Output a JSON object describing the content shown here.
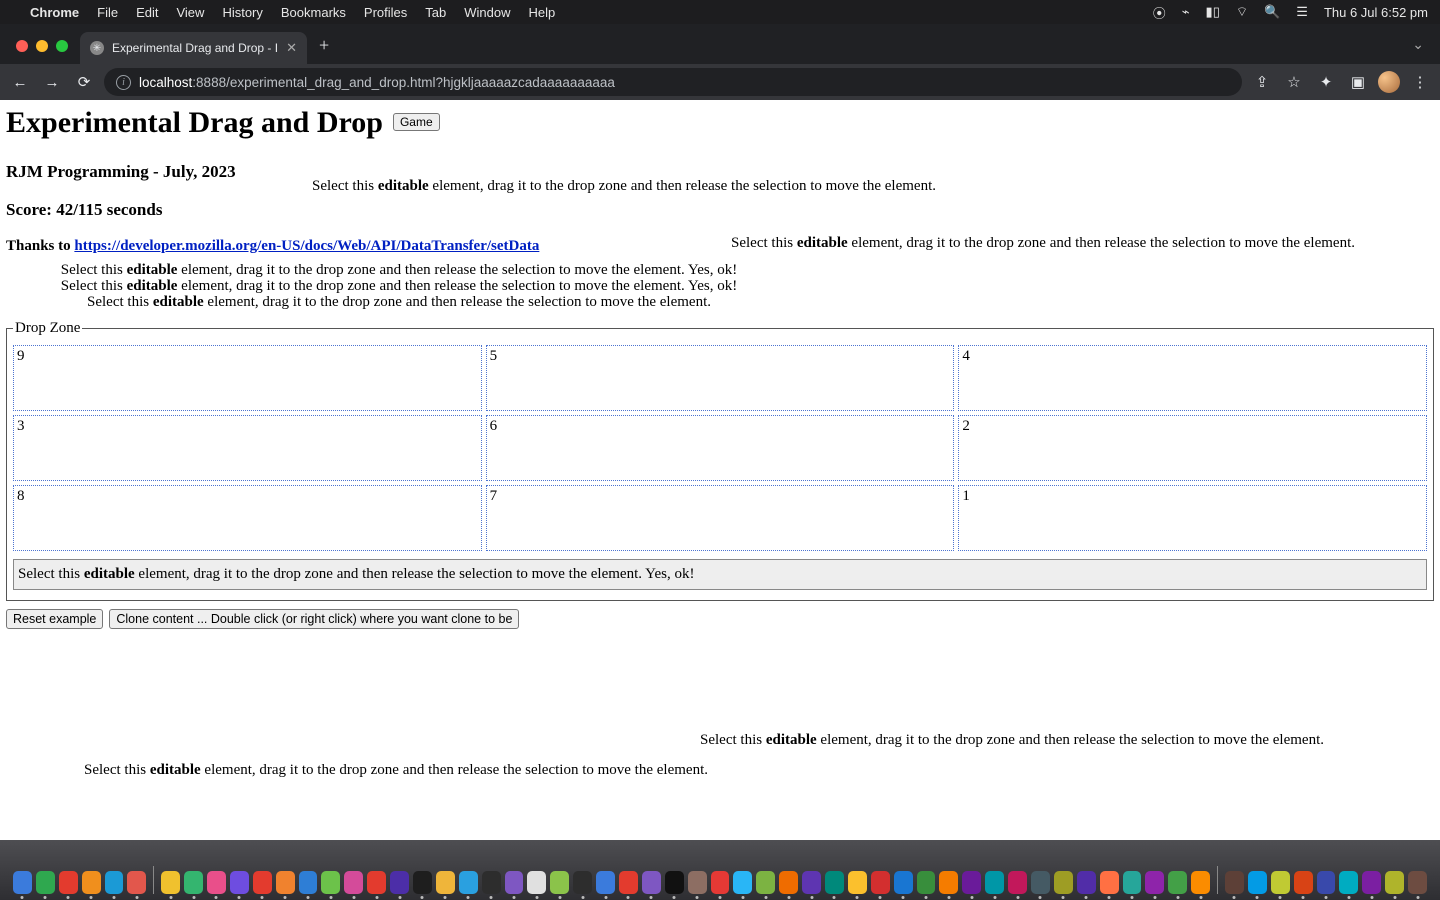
{
  "menubar": {
    "app": "Chrome",
    "items": [
      "File",
      "Edit",
      "View",
      "History",
      "Bookmarks",
      "Profiles",
      "Tab",
      "Window",
      "Help"
    ],
    "clock": "Thu 6 Jul  6:52 pm"
  },
  "browser": {
    "tab_title": "Experimental Drag and Drop - I",
    "url_host": "localhost",
    "url_rest": ":8888/experimental_drag_and_drop.html?hjgkljaaaaazcadaaaaaaaaaa"
  },
  "page": {
    "h1": "Experimental Drag and Drop",
    "game_button": "Game",
    "subtitle": "RJM Programming - July, 2023",
    "score_label": "Score: 42/115 seconds",
    "thanks_prefix": "Thanks to ",
    "thanks_link": "https://developer.mozilla.org/en-US/docs/Web/API/DataTransfer/setData",
    "instruction_plain_pre": "Select this ",
    "instruction_bold": "editable",
    "instruction_plain_post": " element, drag it to the drop zone and then release the selection to move the element.",
    "instruction_ok_suffix": " Yes, ok!",
    "dropzone_legend": "Drop Zone",
    "grid_values": [
      "9",
      "5",
      "4",
      "3",
      "6",
      "2",
      "8",
      "7",
      "1"
    ],
    "result_pre": "Select this ",
    "result_bold": "editable",
    "result_post": " element, drag it to the drop zone and then release the selection to move the element. Yes, ok!",
    "reset_btn": "Reset example",
    "clone_btn": "Clone content ... Double click (or right click) where you want clone to be"
  },
  "dock_colors": [
    "#3b7bdc",
    "#2fa84f",
    "#e33b2e",
    "#f08f1d",
    "#1b9ad6",
    "#e2574c",
    "#f0c12e",
    "#34b56f",
    "#e94f8a",
    "#6e4de0",
    "#e33b2e",
    "#f0822e",
    "#2e7ed6",
    "#6cc24a",
    "#d44b9a",
    "#e33b2e",
    "#4c2ea8",
    "#1e1e1e",
    "#efb53a",
    "#2aa0e0",
    "#2d2d2d",
    "#7e57c2",
    "#e0e0e0",
    "#8bc34a",
    "#2d2d2d",
    "#3b7bdc",
    "#e33b2e",
    "#7e57c2",
    "#111",
    "#8d6e63",
    "#e53935",
    "#29b6f6",
    "#7cb342",
    "#ef6c00",
    "#5e35b1",
    "#00897b",
    "#fbc02d",
    "#d32f2f",
    "#1976d2",
    "#388e3c",
    "#f57c00",
    "#6a1b9a",
    "#0097a7",
    "#c2185b",
    "#455a64",
    "#9e9d24",
    "#512da8",
    "#ff7043",
    "#26a69a",
    "#8e24aa",
    "#43a047",
    "#fb8c00",
    "#5d4037",
    "#039be5",
    "#c0ca33",
    "#d84315",
    "#3949ab",
    "#00acc1",
    "#7b1fa2",
    "#afb42b",
    "#6d4c41"
  ]
}
